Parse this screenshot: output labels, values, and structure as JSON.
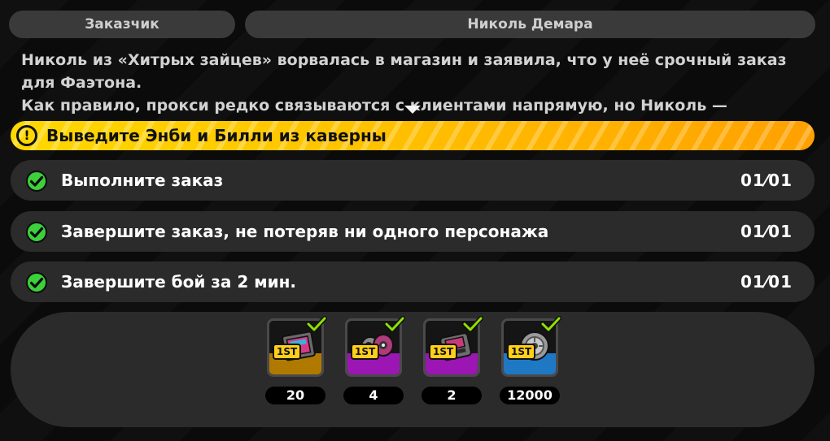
{
  "header": {
    "client_label": "Заказчик",
    "client_name": "Николь Демара"
  },
  "description": {
    "line1": "Николь из «Хитрых зайцев» ворвалась в магазин и заявила, что у неё срочный заказ для Фаэтона.",
    "line2": "Как правило, прокси редко связываются с клиентами напрямую, но Николь —"
  },
  "quest": {
    "icon": "exclamation-icon",
    "title": "Выведите Энби и Билли из каверны",
    "accent": "#ffc400"
  },
  "objectives": [
    {
      "label": "Выполните заказ",
      "count": "01⁄01",
      "done": true
    },
    {
      "label": "Завершите заказ, не потеряв ни одного персонажа",
      "count": "01⁄01",
      "done": true
    },
    {
      "label": "Завершите бой за 2 мин.",
      "count": "01⁄01",
      "done": true
    }
  ],
  "rewards": [
    {
      "icon": "film-item-icon",
      "badge": "1ST",
      "qty": "20",
      "rarity_color": "#b07a00"
    },
    {
      "icon": "bangboo-item-icon",
      "badge": "1ST",
      "qty": "4",
      "rarity_color": "#9b16b3"
    },
    {
      "icon": "chip-item-icon",
      "badge": "1ST",
      "qty": "2",
      "rarity_color": "#9b16b3"
    },
    {
      "icon": "denny-coin-icon",
      "badge": "1ST",
      "qty": "12000",
      "rarity_color": "#1f78c4"
    }
  ]
}
